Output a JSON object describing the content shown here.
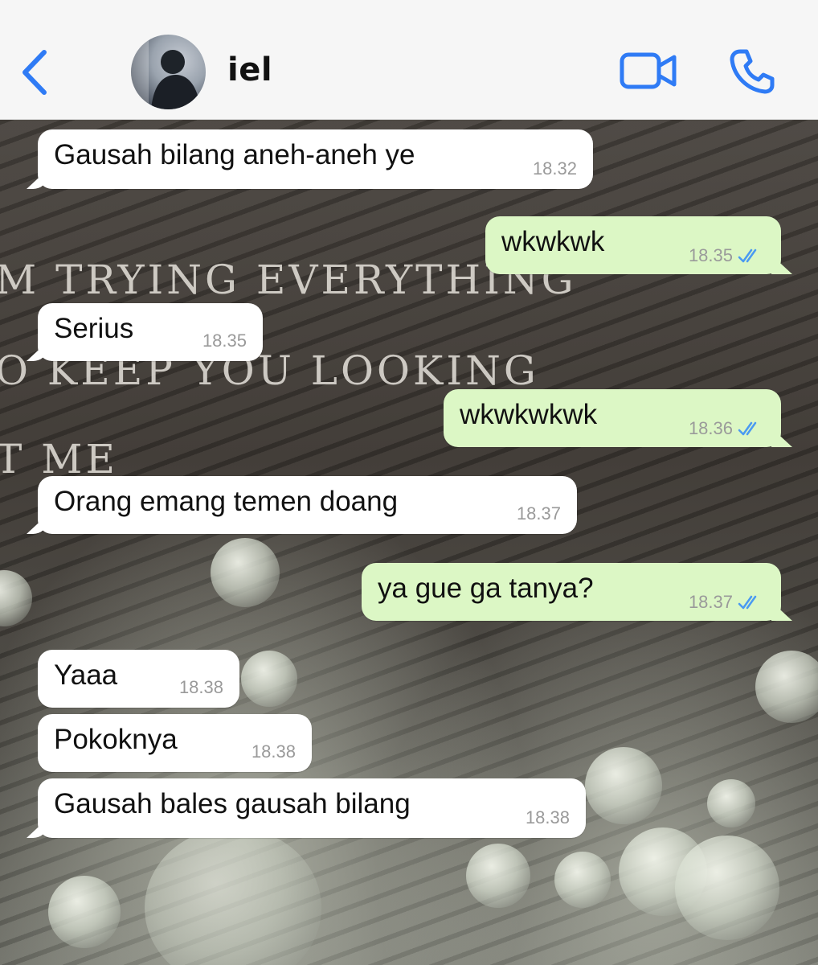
{
  "header": {
    "back_icon": "chevron-left-icon",
    "contact_name": "iel",
    "video_icon": "video-camera-icon",
    "call_icon": "phone-icon",
    "accent_color": "#2f7bf5"
  },
  "wallpaper": {
    "lines": [
      "M TRYING EVERYTHING",
      "O KEEP YOU LOOKING",
      "T ME"
    ]
  },
  "messages": [
    {
      "direction": "in",
      "text": "Gausah bilang aneh-aneh ye",
      "time": "18.32"
    },
    {
      "direction": "out",
      "text": "wkwkwk",
      "time": "18.35",
      "status": "read"
    },
    {
      "direction": "in",
      "text": "Serius",
      "time": "18.35"
    },
    {
      "direction": "out",
      "text": "wkwkwkwk",
      "time": "18.36",
      "status": "read"
    },
    {
      "direction": "in",
      "text": "Orang emang temen doang",
      "time": "18.37"
    },
    {
      "direction": "out",
      "text": "ya gue ga tanya?",
      "time": "18.37",
      "status": "read"
    },
    {
      "direction": "in",
      "text": "Yaaa",
      "time": "18.38"
    },
    {
      "direction": "in",
      "text": "Pokoknya",
      "time": "18.38"
    },
    {
      "direction": "in",
      "text": "Gausah bales gausah bilang",
      "time": "18.38"
    }
  ],
  "colors": {
    "incoming_bubble": "#ffffff",
    "outgoing_bubble": "#dcf7c5",
    "read_ticks": "#4a9af2",
    "timestamp": "#9a9a9a"
  }
}
